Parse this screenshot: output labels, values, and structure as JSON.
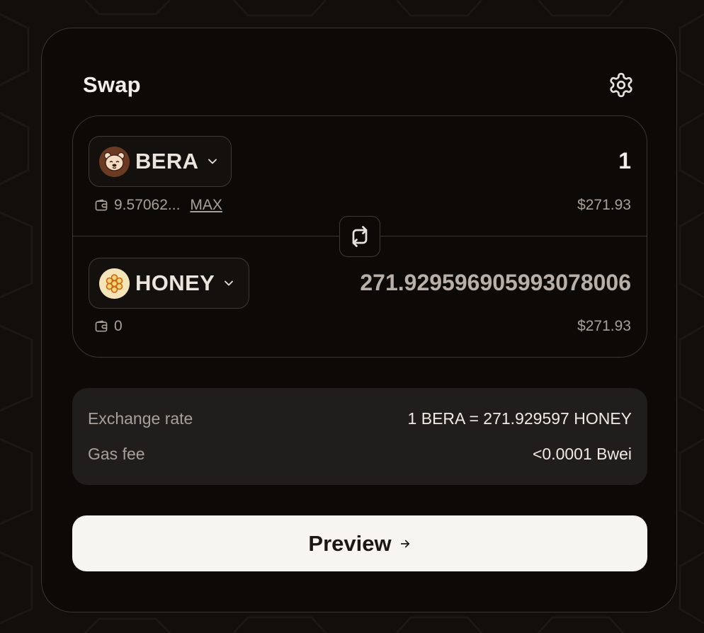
{
  "swap": {
    "title": "Swap"
  },
  "from_token": {
    "symbol": "BERA",
    "amount": "1",
    "balance": "9.57062...",
    "max_label": "MAX",
    "usd_value": "$271.93"
  },
  "to_token": {
    "symbol": "HONEY",
    "amount": "271.929596905993078006",
    "balance": "0",
    "usd_value": "$271.93"
  },
  "info": {
    "exchange_rate_label": "Exchange rate",
    "exchange_rate_value": "1 BERA = 271.929597 HONEY",
    "gas_fee_label": "Gas fee",
    "gas_fee_value": "<0.0001 Bwei"
  },
  "preview_button": {
    "label": "Preview"
  },
  "icons": {
    "settings": "gear-icon",
    "from_token_logo": "bera-bear-logo",
    "to_token_logo": "honey-honeycomb-logo",
    "chevron": "chevron-down-icon",
    "wallet": "wallet-icon",
    "switch": "swap-arrows-icon",
    "arrow": "arrow-right-icon"
  },
  "colors": {
    "background": "#120e0b",
    "card": "#0c0906",
    "border": "#3a3530",
    "info_panel": "#201e1c",
    "button": "#f7f5f1",
    "bera_logo": "#6b3a22",
    "honey_logo": "#f4e4b8"
  }
}
